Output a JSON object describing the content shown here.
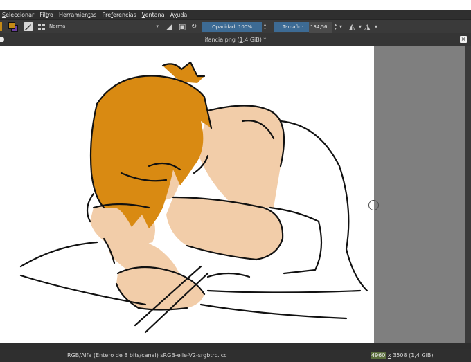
{
  "menu": {
    "items": [
      {
        "pre": "",
        "mn": "S",
        "post": "eleccionar"
      },
      {
        "pre": "Fil",
        "mn": "t",
        "post": "ro"
      },
      {
        "pre": "Herramien",
        "mn": "t",
        "post": "as"
      },
      {
        "pre": "Pre",
        "mn": "f",
        "post": "erencias"
      },
      {
        "pre": "",
        "mn": "V",
        "post": "entana"
      },
      {
        "pre": "A",
        "mn": "y",
        "post": "uda"
      }
    ]
  },
  "toolbar": {
    "blend_mode": "Normal",
    "opacity_label": "Opacidad: 100%",
    "size_label": "Tamaño: ",
    "size_value": "134,56 px",
    "opacity_value": 1.0
  },
  "document": {
    "title_pre": "ifancia.png (",
    "title_mn": "1",
    "title_post": ",4 GiB) *",
    "close": "×"
  },
  "status": {
    "color_space": "RGB/Alfa (Entero de 8 bits/canal)  sRGB-elle-V2-srgbtrc.icc",
    "width": "4960",
    "x": "x",
    "rest": " 3508 (1,4 GiB)"
  },
  "colors": {
    "hair": "#d98a12",
    "skin": "#f2cda9",
    "ui_dark": "#2f2f2f",
    "accent_slider": "#3d6b94",
    "canvas_surround": "#7f7f7f"
  },
  "icons": [
    "brush-preset-icon",
    "grid-icon",
    "eraser-icon",
    "alpha-lock-icon",
    "reload-icon",
    "mirror-icon",
    "wrap-icon",
    "close-icon"
  ]
}
